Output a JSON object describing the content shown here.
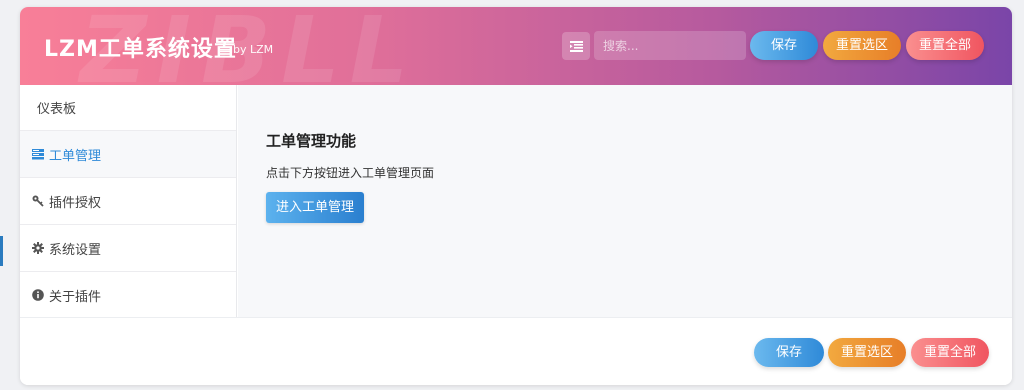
{
  "header": {
    "title": "LZM工单系统设置",
    "byline": "by LZM",
    "watermark": "ZIBLL",
    "search_placeholder": "搜索...",
    "save_label": "保存",
    "reset_section_label": "重置选区",
    "reset_all_label": "重置全部"
  },
  "sidebar": {
    "items": [
      {
        "label": "仪表板",
        "icon": "none"
      },
      {
        "label": "工单管理",
        "icon": "server-icon",
        "active": true
      },
      {
        "label": "插件授权",
        "icon": "key-icon"
      },
      {
        "label": "系统设置",
        "icon": "gear-icon"
      },
      {
        "label": "关于插件",
        "icon": "info-icon"
      }
    ]
  },
  "main": {
    "section_title": "工单管理功能",
    "section_desc": "点击下方按钮进入工单管理页面",
    "enter_button_label": "进入工单管理"
  },
  "footer": {
    "save_label": "保存",
    "reset_section_label": "重置选区",
    "reset_all_label": "重置全部"
  },
  "colors": {
    "accent": "#2f8ad8",
    "header_gradient_start": "#f87f98",
    "header_gradient_end": "#7a45a8",
    "save_button": "#2f8ad8",
    "reset_section_button": "#e77e28",
    "reset_all_button": "#f05560"
  }
}
